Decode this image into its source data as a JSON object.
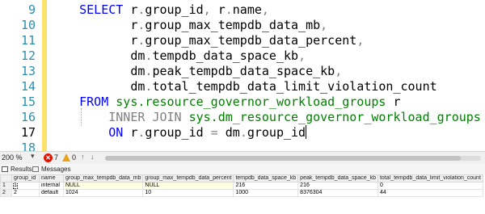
{
  "editor": {
    "line_numbers": [
      "9",
      "10",
      "11",
      "12",
      "13",
      "14",
      "15",
      "16",
      "17",
      "18"
    ],
    "current_line": "17",
    "lines": [
      [
        {
          "t": "    ",
          "c": "pl"
        },
        {
          "t": "SELECT",
          "c": "kw"
        },
        {
          "t": " r",
          "c": "pl"
        },
        {
          "t": ".",
          "c": "gr"
        },
        {
          "t": "group_id",
          "c": "pl"
        },
        {
          "t": ",",
          "c": "gr"
        },
        {
          "t": " r",
          "c": "pl"
        },
        {
          "t": ".",
          "c": "gr"
        },
        {
          "t": "name",
          "c": "pl"
        },
        {
          "t": ",",
          "c": "gr"
        }
      ],
      [
        {
          "t": "           r",
          "c": "pl"
        },
        {
          "t": ".",
          "c": "gr"
        },
        {
          "t": "group_max_tempdb_data_mb",
          "c": "pl"
        },
        {
          "t": ",",
          "c": "gr"
        }
      ],
      [
        {
          "t": "           r",
          "c": "pl"
        },
        {
          "t": ".",
          "c": "gr"
        },
        {
          "t": "group_max_tempdb_data_percent",
          "c": "pl"
        },
        {
          "t": ",",
          "c": "gr"
        }
      ],
      [
        {
          "t": "           dm",
          "c": "pl"
        },
        {
          "t": ".",
          "c": "gr"
        },
        {
          "t": "tempdb_data_space_kb",
          "c": "pl"
        },
        {
          "t": ",",
          "c": "gr"
        }
      ],
      [
        {
          "t": "           dm",
          "c": "pl"
        },
        {
          "t": ".",
          "c": "gr"
        },
        {
          "t": "peak_tempdb_data_space_kb",
          "c": "pl"
        },
        {
          "t": ",",
          "c": "gr"
        }
      ],
      [
        {
          "t": "           dm",
          "c": "pl"
        },
        {
          "t": ".",
          "c": "gr"
        },
        {
          "t": "total_tempdb_data_limit_violation_count",
          "c": "pl"
        }
      ],
      [
        {
          "t": "    ",
          "c": "pl"
        },
        {
          "t": "FROM",
          "c": "kw"
        },
        {
          "t": " sys.resource_governor_workload_groups",
          "c": "sy"
        },
        {
          "t": " r",
          "c": "pl"
        }
      ],
      [
        {
          "t": "        ",
          "c": "pl"
        },
        {
          "t": "INNER",
          "c": "gr"
        },
        {
          "t": " ",
          "c": "pl"
        },
        {
          "t": "JOIN",
          "c": "gr"
        },
        {
          "t": " sys.dm_resource_governor_workload_groups",
          "c": "sy"
        },
        {
          "t": " dm",
          "c": "pl"
        }
      ],
      [
        {
          "t": "        ",
          "c": "pl"
        },
        {
          "t": "ON",
          "c": "kw"
        },
        {
          "t": " r",
          "c": "pl"
        },
        {
          "t": ".",
          "c": "gr"
        },
        {
          "t": "group_id",
          "c": "pl"
        },
        {
          "t": " = ",
          "c": "gr"
        },
        {
          "t": "dm",
          "c": "pl"
        },
        {
          "t": ".",
          "c": "gr"
        },
        {
          "t": "group_id",
          "c": "pl"
        },
        {
          "t": "|caret|",
          "c": "caret"
        }
      ],
      []
    ]
  },
  "statusbar": {
    "zoom": "200 %",
    "zoom_arrow": "▾",
    "error_count": "7",
    "warning_count": "0",
    "nav_prev": "↑",
    "nav_next": "↓"
  },
  "tabs": {
    "results": "Results",
    "messages": "Messages"
  },
  "grid": {
    "columns": [
      "",
      "group_id",
      "name",
      "group_max_tempdb_data_mb",
      "group_max_tempdb_data_percent",
      "tempdb_data_space_kb",
      "peak_tempdb_data_space_kb",
      "total_tempdb_data_limit_violation_count"
    ],
    "rows": [
      [
        "1",
        "1",
        "internal",
        "NULL",
        "NULL",
        "216",
        "216",
        "0"
      ],
      [
        "2",
        "2",
        "default",
        "1024",
        "10",
        "1000",
        "8376304",
        "44"
      ]
    ]
  },
  "colors": {
    "keyword": "#0000ff",
    "operator": "#808080",
    "system_object": "#008000",
    "line_number": "#2b91af",
    "change_bar": "#fbe26d",
    "null_cell": "#ffffe1",
    "error": "#e51400",
    "warning": "#e8a317"
  }
}
